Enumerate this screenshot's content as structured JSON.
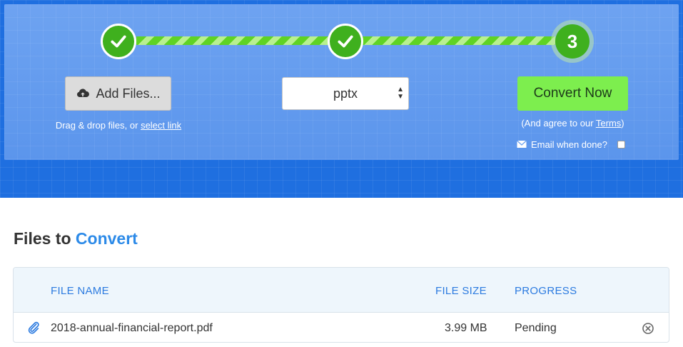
{
  "steps": [
    {
      "state": "done",
      "icon": "check-icon"
    },
    {
      "state": "done",
      "icon": "check-icon"
    },
    {
      "state": "current",
      "number": "3"
    }
  ],
  "upload": {
    "button_label": "Add Files...",
    "icon": "cloud-upload-icon",
    "hint_text": "Drag & drop files, or ",
    "hint_link": "select link"
  },
  "format": {
    "selected": "pptx"
  },
  "convert": {
    "button_label": "Convert Now",
    "agree_prefix": "(And agree to our ",
    "agree_link": "Terms",
    "agree_suffix": ")",
    "email_label": "Email when done?",
    "email_checked": false
  },
  "files_section": {
    "title_prefix": "Files to ",
    "title_accent": "Convert",
    "columns": [
      "FILE NAME",
      "FILE SIZE",
      "PROGRESS"
    ],
    "rows": [
      {
        "name": "2018-annual-financial-report.pdf",
        "size": "3.99 MB",
        "progress": "Pending"
      }
    ]
  },
  "colors": {
    "hero_blue": "#1f6fe0",
    "panel_blue": "#6aa0ef",
    "step_green": "#3fb01e",
    "convert_green": "#7dee4e",
    "accent_blue": "#2c8ae8"
  }
}
